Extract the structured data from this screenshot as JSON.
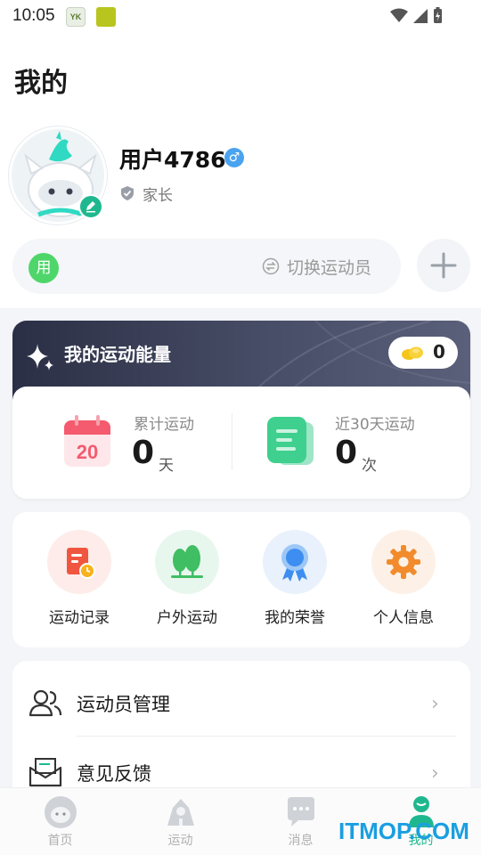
{
  "status_bar": {
    "time": "10:05",
    "app_icon_1_text": "YK"
  },
  "page": {
    "title": "我的"
  },
  "profile": {
    "username": "用户4786",
    "gender_symbol": "♂",
    "role": "家长"
  },
  "athlete_switch": {
    "avatar_char": "用",
    "switch_label": "切换运动员"
  },
  "energy": {
    "title": "我的运动能量",
    "coins": "0",
    "calendar_day": "20",
    "stats": [
      {
        "label": "累计运动",
        "value": "0",
        "unit": "天"
      },
      {
        "label": "近30天运动",
        "value": "0",
        "unit": "次"
      }
    ]
  },
  "quick_actions": [
    {
      "label": "运动记录",
      "icon": "record-icon",
      "bg": "#fdecea"
    },
    {
      "label": "户外运动",
      "icon": "tree-icon",
      "bg": "#e8f7ee"
    },
    {
      "label": "我的荣誉",
      "icon": "medal-icon",
      "bg": "#e9f1fc"
    },
    {
      "label": "个人信息",
      "icon": "gear-icon",
      "bg": "#fdf1e7"
    }
  ],
  "menu_list": [
    {
      "label": "运动员管理",
      "icon": "users-icon"
    },
    {
      "label": "意见反馈",
      "icon": "mail-icon"
    }
  ],
  "bottom_nav": [
    {
      "label": "首页",
      "icon": "home-avatar-icon",
      "active": false
    },
    {
      "label": "运动",
      "icon": "sport-icon",
      "active": false
    },
    {
      "label": "消息",
      "icon": "chat-icon",
      "active": false
    },
    {
      "label": "我的",
      "icon": "profile-icon",
      "active": true
    }
  ],
  "watermark": "ITMOP.COM",
  "colors": {
    "accent": "#1fb88e",
    "energy_header": "#2b2f45",
    "background": "#f3f5f8"
  }
}
